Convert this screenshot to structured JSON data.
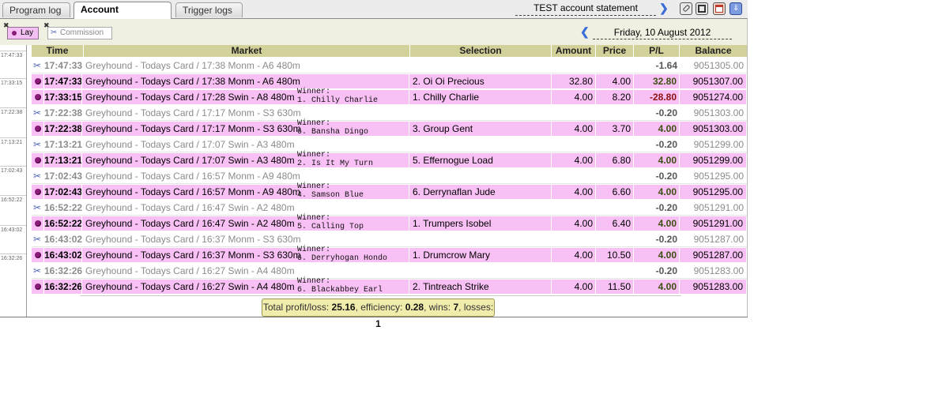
{
  "tabs": [
    {
      "label": "Program log",
      "active": false
    },
    {
      "label": "Account statement",
      "active": true
    },
    {
      "label": "Trigger logs",
      "active": false
    }
  ],
  "header": {
    "account_title": "TEST account statement",
    "toolbar_icons": [
      "edit-icon",
      "save-icon",
      "calendar-icon",
      "download-icon"
    ]
  },
  "filters": {
    "lay_label": "Lay",
    "commission_label": "Commission",
    "date": "Friday, 10 August 2012"
  },
  "gutter_times": [
    "17:47:33",
    "17:33:15",
    "17:22:38",
    "17:13:21",
    "17:02:43",
    "16:52:22",
    "16:43:02",
    "16:32:26"
  ],
  "columns": {
    "time": "Time",
    "market": "Market",
    "selection": "Selection",
    "amount": "Amount",
    "price": "Price",
    "pl": "P/L",
    "balance": "Balance"
  },
  "rows": [
    {
      "kind": "comm",
      "time": "17:47:33",
      "market": "Greyhound - Todays Card / 17:38 Monm - A6 480m",
      "winner": "",
      "selection": "",
      "amount": "",
      "price": "",
      "pl": "-1.64",
      "balance": "9051305.00"
    },
    {
      "kind": "bet",
      "time": "17:47:33",
      "market": "Greyhound - Todays Card / 17:38 Monm - A6 480m",
      "winner": "",
      "selection": "2. Oi Oi Precious",
      "amount": "32.80",
      "price": "4.00",
      "pl": "32.80",
      "balance": "9051307.00"
    },
    {
      "kind": "bet",
      "time": "17:33:15",
      "market": "Greyhound - Todays Card / 17:28 Swin - A8 480m",
      "winner": "Winner:\n1. Chilly Charlie",
      "selection": "1. Chilly Charlie",
      "amount": "4.00",
      "price": "8.20",
      "pl": "-28.80",
      "balance": "9051274.00"
    },
    {
      "kind": "comm",
      "time": "17:22:38",
      "market": "Greyhound - Todays Card / 17:17 Monm - S3 630m",
      "winner": "",
      "selection": "",
      "amount": "",
      "price": "",
      "pl": "-0.20",
      "balance": "9051303.00"
    },
    {
      "kind": "bet",
      "time": "17:22:38",
      "market": "Greyhound - Todays Card / 17:17 Monm - S3 630m",
      "winner": "Winner:\n6. Bansha Dingo",
      "selection": "3. Group Gent",
      "amount": "4.00",
      "price": "3.70",
      "pl": "4.00",
      "balance": "9051303.00"
    },
    {
      "kind": "comm",
      "time": "17:13:21",
      "market": "Greyhound - Todays Card / 17:07 Swin - A3 480m",
      "winner": "",
      "selection": "",
      "amount": "",
      "price": "",
      "pl": "-0.20",
      "balance": "9051299.00"
    },
    {
      "kind": "bet",
      "time": "17:13:21",
      "market": "Greyhound - Todays Card / 17:07 Swin - A3 480m",
      "winner": "Winner:\n2. Is It My Turn",
      "selection": "5. Effernogue Load",
      "amount": "4.00",
      "price": "6.80",
      "pl": "4.00",
      "balance": "9051299.00"
    },
    {
      "kind": "comm",
      "time": "17:02:43",
      "market": "Greyhound - Todays Card / 16:57 Monm - A9 480m",
      "winner": "",
      "selection": "",
      "amount": "",
      "price": "",
      "pl": "-0.20",
      "balance": "9051295.00"
    },
    {
      "kind": "bet",
      "time": "17:02:43",
      "market": "Greyhound - Todays Card / 16:57 Monm - A9 480m",
      "winner": "Winner:\n4. Samson Blue",
      "selection": "6. Derrynaflan Jude",
      "amount": "4.00",
      "price": "6.60",
      "pl": "4.00",
      "balance": "9051295.00"
    },
    {
      "kind": "comm",
      "time": "16:52:22",
      "market": "Greyhound - Todays Card / 16:47 Swin - A2 480m",
      "winner": "",
      "selection": "",
      "amount": "",
      "price": "",
      "pl": "-0.20",
      "balance": "9051291.00"
    },
    {
      "kind": "bet",
      "time": "16:52:22",
      "market": "Greyhound - Todays Card / 16:47 Swin - A2 480m",
      "winner": "Winner:\n5. Calling Top",
      "selection": "1. Trumpers Isobel",
      "amount": "4.00",
      "price": "6.40",
      "pl": "4.00",
      "balance": "9051291.00"
    },
    {
      "kind": "comm",
      "time": "16:43:02",
      "market": "Greyhound - Todays Card / 16:37 Monm - S3 630m",
      "winner": "",
      "selection": "",
      "amount": "",
      "price": "",
      "pl": "-0.20",
      "balance": "9051287.00"
    },
    {
      "kind": "bet",
      "time": "16:43:02",
      "market": "Greyhound - Todays Card / 16:37 Monm - S3 630m",
      "winner": "Winner:\n6. Derryhogan Hondo",
      "selection": "1. Drumcrow Mary",
      "amount": "4.00",
      "price": "10.50",
      "pl": "4.00",
      "balance": "9051287.00"
    },
    {
      "kind": "comm",
      "time": "16:32:26",
      "market": "Greyhound - Todays Card / 16:27 Swin - A4 480m",
      "winner": "",
      "selection": "",
      "amount": "",
      "price": "",
      "pl": "-0.20",
      "balance": "9051283.00"
    },
    {
      "kind": "bet",
      "time": "16:32:26",
      "market": "Greyhound - Todays Card / 16:27 Swin - A4 480m",
      "winner": "Winner:\n6. Blackabbey Earl",
      "selection": "2. Tintreach Strike",
      "amount": "4.00",
      "price": "11.50",
      "pl": "4.00",
      "balance": "9051283.00"
    }
  ],
  "summary": {
    "profit_label": "Total profit/loss:",
    "profit_value": "25.16",
    "efficiency_label": "efficiency:",
    "efficiency_value": "0.28",
    "wins_label": "wins:",
    "wins_value": "7",
    "losses_label": "losses:",
    "losses_value": "1"
  },
  "colors": {
    "bet_row": "#f8c0f4",
    "header": "#d3d19a",
    "summary_bg": "#f0ecac",
    "accent": "#3a6ed6",
    "lay_dot": "#8a1b78"
  }
}
